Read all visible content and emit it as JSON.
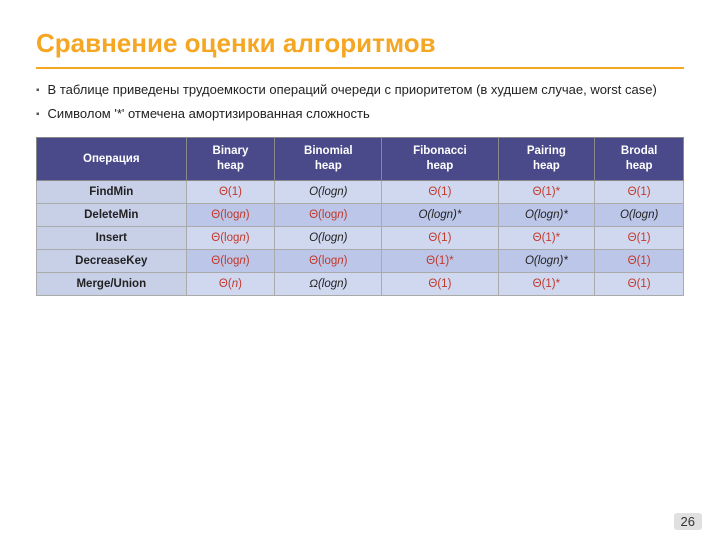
{
  "title": "Сравнение оценки алгоритмов",
  "bullets": [
    "В таблице приведены трудоемкости операций очереди  с приоритетом (в худшем случае, worst case)",
    "Символом '*' отмечена амортизированная сложность"
  ],
  "table": {
    "headers": [
      "Операция",
      "Binary heap",
      "Binomial heap",
      "Fibonacci heap",
      "Pairing heap",
      "Brodal heap"
    ],
    "rows": [
      {
        "op": "FindMin",
        "binary": {
          "text": "Θ(1)",
          "theta": true,
          "italic": false
        },
        "binomial": {
          "text": "O(log",
          "n": "n",
          "close": ")",
          "italic": true,
          "theta": false
        },
        "fibonacci": {
          "text": "Θ(1)",
          "theta": true
        },
        "pairing": {
          "text": "Θ(1)*",
          "theta": true
        },
        "brodal": {
          "text": "Θ(1)",
          "theta": true
        }
      },
      {
        "op": "DeleteMin",
        "binary": {
          "text": "Θ(log",
          "n": "n",
          "close": ")",
          "theta": true
        },
        "binomial": {
          "text": "Θ(log",
          "n": "n",
          "close": ")",
          "theta": true
        },
        "fibonacci": {
          "text": "O(log",
          "n": "n",
          "close": ")*",
          "italic": true,
          "theta": false
        },
        "pairing": {
          "text": "O(log",
          "n": "n",
          "close": ")*",
          "italic": true,
          "theta": false
        },
        "brodal": {
          "text": "O(log",
          "n": "n",
          "close": ")",
          "italic": true,
          "theta": false
        }
      },
      {
        "op": "Insert",
        "binary": {
          "text": "Θ(log",
          "n": "n",
          "close": ")",
          "theta": true
        },
        "binomial": {
          "text": "O(log",
          "n": "n",
          "close": ")",
          "italic": true,
          "theta": false
        },
        "fibonacci": {
          "text": "Θ(1)",
          "theta": true
        },
        "pairing": {
          "text": "Θ(1)*",
          "theta": true
        },
        "brodal": {
          "text": "Θ(1)",
          "theta": true
        }
      },
      {
        "op": "DecreaseKey",
        "binary": {
          "text": "Θ(log",
          "n": "n",
          "close": ")",
          "theta": true
        },
        "binomial": {
          "text": "Θ(log",
          "n": "n",
          "close": ")",
          "theta": true
        },
        "fibonacci": {
          "text": "Θ(1)*",
          "theta": true
        },
        "pairing": {
          "text": "O(log",
          "n": "n",
          "close": ")*",
          "italic": true,
          "theta": false
        },
        "brodal": {
          "text": "Θ(1)",
          "theta": true
        }
      },
      {
        "op": "Merge/Union",
        "binary": {
          "text": "Θ(",
          "n": "n",
          "close": ")",
          "theta": true
        },
        "binomial": {
          "text": "Ω(log",
          "n": "n",
          "close": ")",
          "italic": true,
          "theta": false,
          "omega": true
        },
        "fibonacci": {
          "text": "Θ(1)",
          "theta": true
        },
        "pairing": {
          "text": "Θ(1)*",
          "theta": true
        },
        "brodal": {
          "text": "Θ(1)",
          "theta": true
        }
      }
    ]
  },
  "slide_number": "26"
}
